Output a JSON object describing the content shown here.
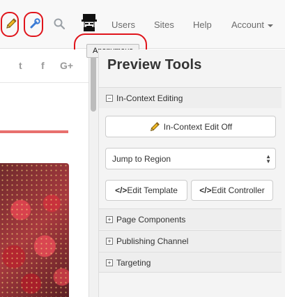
{
  "navbar": {
    "links": [
      "Users",
      "Sites",
      "Help"
    ],
    "account_label": "Account",
    "tooltip": "Anonymous"
  },
  "panel": {
    "title": "Preview Tools",
    "sections": {
      "in_context_editing": "In-Context Editing",
      "page_components": "Page Components",
      "publishing_channel": "Publishing Channel",
      "targeting": "Targeting"
    },
    "edit_toggle_label": "In-Context Edit Off",
    "region_select_value": "Jump to Region",
    "edit_template_label": "Edit Template",
    "edit_controller_label": "Edit Controller",
    "code_glyph": "</>"
  },
  "social": [
    "twitter-icon",
    "facebook-icon",
    "google-plus-icon"
  ],
  "social_glyphs": [
    "t",
    "f",
    "G+"
  ],
  "colors": {
    "annotation": "#e0141b",
    "accent_rule": "#e8706e",
    "link_gray": "#6b6b6b"
  }
}
